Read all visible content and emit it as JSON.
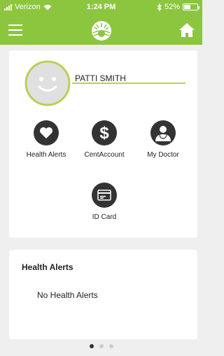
{
  "status_bar": {
    "carrier": "Verizon",
    "time": "1:24 PM",
    "battery": "52%",
    "battery_level": 0.52,
    "icons": [
      "signal-icon",
      "wifi-icon",
      "bluetooth-icon",
      "battery-icon"
    ]
  },
  "header": {
    "menu_icon": "hamburger-menu-icon",
    "logo_icon": "sunrise-logo-icon",
    "home_icon": "home-icon",
    "bar_color": "#8cc63f"
  },
  "profile": {
    "name": "PATTI SMITH",
    "avatar_icon": "smiley-avatar-icon",
    "accent_color": "#b7d155"
  },
  "tiles": [
    {
      "label": "Health Alerts",
      "icon": "heart-icon"
    },
    {
      "label": "CentAccount",
      "icon": "dollar-icon"
    },
    {
      "label": "My Doctor",
      "icon": "doctor-icon"
    },
    {
      "label": "ID Card",
      "icon": "id-card-icon"
    }
  ],
  "alerts": {
    "title": "Health Alerts",
    "empty_text": "No Health Alerts"
  },
  "pager": {
    "page_count": 3,
    "active_page": 1
  }
}
